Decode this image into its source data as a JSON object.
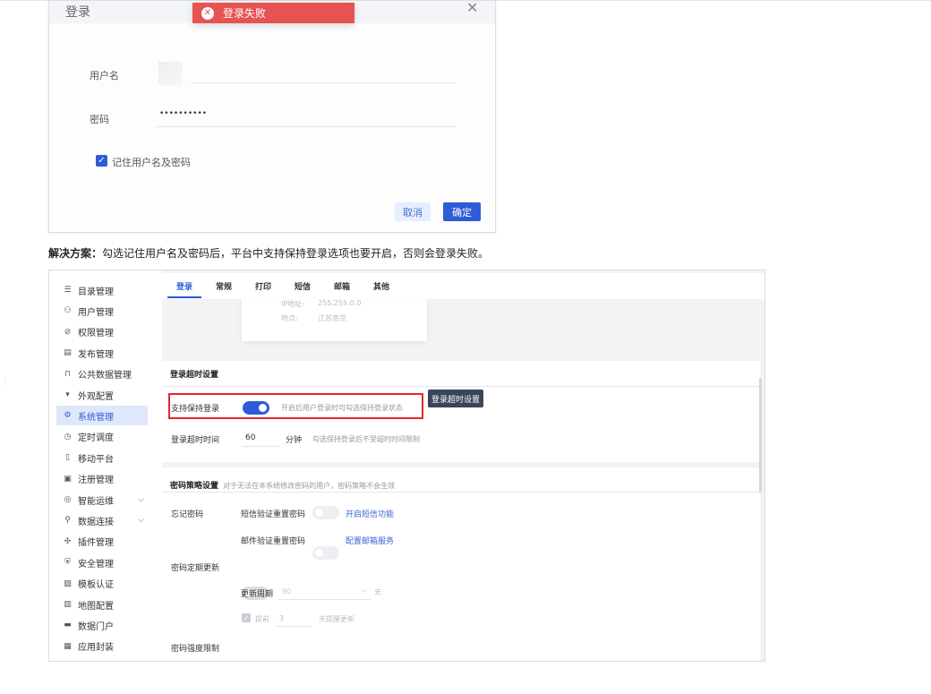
{
  "login_dialog": {
    "title": "登录",
    "toast": "登录失败",
    "username_label": "用户名",
    "password_label": "密码",
    "password_value": "••••••••••",
    "remember_label": "记住用户名及密码",
    "cancel": "取消",
    "confirm": "确定"
  },
  "note": {
    "bold": "解决方案：",
    "text": "勾选记住用户名及密码后，平台中支持保持登录选项也要开启，否则会登录失败。"
  },
  "settings": {
    "sidebar": [
      {
        "label": "目录管理",
        "icon": "☰"
      },
      {
        "label": "用户管理",
        "icon": "⚇"
      },
      {
        "label": "权限管理",
        "icon": "⊘"
      },
      {
        "label": "发布管理",
        "icon": "▤"
      },
      {
        "label": "公共数据管理",
        "icon": "⊓"
      },
      {
        "label": "外观配置",
        "icon": "▾"
      },
      {
        "label": "系统管理",
        "icon": "⚙"
      },
      {
        "label": "定时调度",
        "icon": "◷"
      },
      {
        "label": "移动平台",
        "icon": "▯"
      },
      {
        "label": "注册管理",
        "icon": "▣"
      },
      {
        "label": "智能运维",
        "icon": "◎"
      },
      {
        "label": "数据连接",
        "icon": "⚲"
      },
      {
        "label": "插件管理",
        "icon": "✣"
      },
      {
        "label": "安全管理",
        "icon": "⛨"
      },
      {
        "label": "模板认证",
        "icon": "▨"
      },
      {
        "label": "地图配置",
        "icon": "▥"
      },
      {
        "label": "数据门户",
        "icon": "▬"
      },
      {
        "label": "应用封装",
        "icon": "▦"
      }
    ],
    "tabs": [
      "登录",
      "常规",
      "打印",
      "短信",
      "邮箱",
      "其他"
    ],
    "card": {
      "ip_label": "IP地址:",
      "ip_value": "255.255.0.0",
      "loc_label": "地点:",
      "loc_value": "江苏南京"
    },
    "timeout": {
      "title": "登录超时设置",
      "keep_label": "支持保持登录",
      "keep_hint": "开启后用户登录时可勾选保持登录状态",
      "button": "登录超时设置",
      "time_label": "登录超时时间",
      "time_value": "60",
      "unit": "分钟",
      "time_hint": "勾选保持登录后不受超时时间限制"
    },
    "password": {
      "title": "密码策略设置",
      "subtitle": "对于无法在本系统修改密码的用户，密码策略不会生效",
      "forgot": "忘记密码",
      "sms_reset": "短信验证重置密码",
      "sms_link": "开启短信功能",
      "mail_reset": "邮件验证重置密码",
      "mail_link": "配置邮箱服务",
      "periodic": "密码定期更新",
      "cycle_label": "更新周期",
      "cycle_value": "90",
      "cycle_unit": "天",
      "advance_label": "提前",
      "advance_value": "3",
      "advance_unit": "天提醒更新",
      "strength": "密码强度限制"
    }
  }
}
